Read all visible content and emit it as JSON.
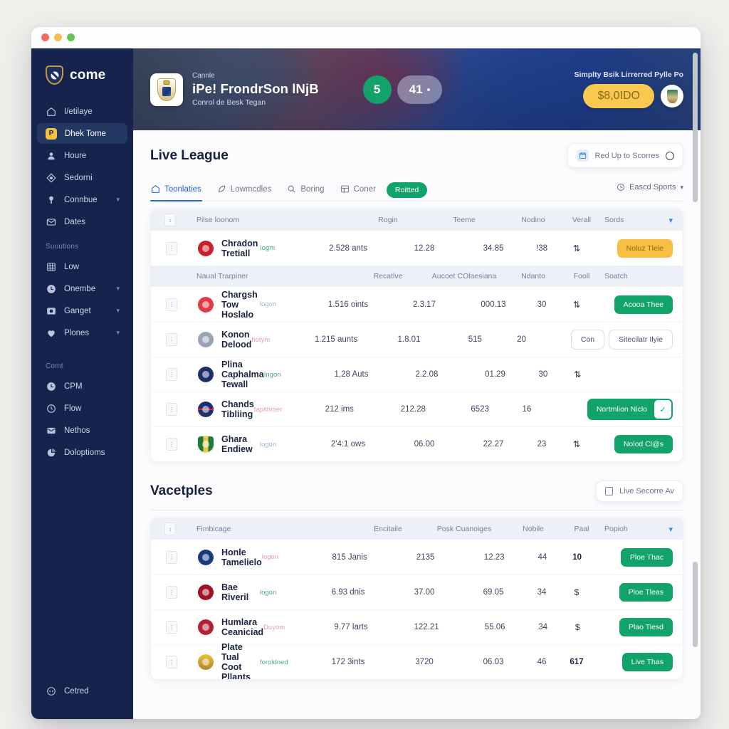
{
  "window": {
    "traffic_lights": [
      "close",
      "minimize",
      "zoom"
    ]
  },
  "sidebar": {
    "brand": "come",
    "sections": [
      {
        "label": "",
        "items": [
          {
            "label": "I/etilaye",
            "icon": "home-icon",
            "active": false,
            "chevron": false
          },
          {
            "label": "Dhek Tome",
            "icon": "badge-p-icon",
            "active": true,
            "chevron": false
          },
          {
            "label": "Houre",
            "icon": "user-icon",
            "active": false,
            "chevron": false
          },
          {
            "label": "Sedorni",
            "icon": "diamond-icon",
            "active": false,
            "chevron": false
          },
          {
            "label": "Connbue",
            "icon": "pin-icon",
            "active": false,
            "chevron": true
          },
          {
            "label": "Dates",
            "icon": "mail-icon",
            "active": false,
            "chevron": false
          }
        ]
      },
      {
        "label": "Suuutions",
        "items": [
          {
            "label": "Low",
            "icon": "grid-icon",
            "active": false,
            "chevron": false
          },
          {
            "label": "Onembe",
            "icon": "clock-icon",
            "active": false,
            "chevron": true
          },
          {
            "label": "Ganget",
            "icon": "camera-icon",
            "active": false,
            "chevron": true
          },
          {
            "label": "Plones",
            "icon": "heart-icon",
            "active": false,
            "chevron": true
          }
        ]
      },
      {
        "label": "Comt",
        "items": [
          {
            "label": "CPM",
            "icon": "clock-icon",
            "active": false,
            "chevron": false
          },
          {
            "label": "Flow",
            "icon": "clock-icon",
            "active": false,
            "chevron": false
          },
          {
            "label": "Nethos",
            "icon": "mail-icon",
            "active": false,
            "chevron": false
          },
          {
            "label": "Doloptioms",
            "icon": "pie-icon",
            "active": false,
            "chevron": false
          }
        ]
      }
    ],
    "bottom": {
      "label": "Cetred",
      "icon": "help-circle-icon"
    }
  },
  "hero": {
    "kicker": "Cannle",
    "title": "iPe! FrondrSon lNjB",
    "subtitle": "Conrol de Besk Tegan",
    "crest": "team-crest-icon",
    "score_home": "5",
    "score_away": "41",
    "right_label": "Simplty Bsik Lirrerred Pylle Po",
    "money": "$8,0IDO",
    "avatar": "trophy-avatar-icon"
  },
  "section1": {
    "title": "Live League",
    "action_chip": {
      "label": "Red Up to Scorres",
      "icon": "calendar-icon",
      "trailing": "ring-icon"
    },
    "tabs": [
      {
        "label": "Toonlaties",
        "icon": "home-outline-icon",
        "active": true
      },
      {
        "label": "Lowmcdles",
        "icon": "leaf-icon",
        "active": false
      },
      {
        "label": "Boring",
        "icon": "search-icon",
        "active": false
      },
      {
        "label": "Coner",
        "icon": "grid-small-icon",
        "active": false
      }
    ],
    "tab_pill": "Roitted",
    "tabs_right": {
      "label": "Eascd Sports",
      "icon": "clock-icon",
      "chevron": "chevron-down-icon"
    },
    "table": {
      "columns": [
        "Pilse loonom",
        "Rogin",
        "Teeme",
        "Nodino",
        "Verall",
        "Sords"
      ],
      "columns2": [
        "Naual Trarpiner",
        "Recatlve",
        "Aucoet COlaesiana",
        "Ndanto",
        "Fooll",
        "Soatch"
      ],
      "rows_top": [
        {
          "name": "Chradon Tretiall",
          "tag": "Iogm",
          "tag_color": "#35b07a",
          "crest_color": "#c8202b",
          "crest_shape": "circle",
          "c1": "2.528 ants",
          "c2": "12.28",
          "c3": "34.85",
          "c4": "!38",
          "c5_icon": "updown-icon",
          "c5_text": "",
          "action": {
            "label": "Noluz Tlele",
            "style": "amber"
          }
        }
      ],
      "rows": [
        {
          "name": "Chargsh Tow Hoslalo",
          "tag": "logon",
          "tag_color": "#9fb5d8",
          "crest_color": "#e03a46",
          "crest_shape": "circle",
          "c1": "1.516 oints",
          "c2": "2.3.17",
          "c3": "000.13",
          "c4": "30",
          "c5_icon": "updown-icon",
          "c5_text": "",
          "action": {
            "label": "Acooa Thee",
            "style": "green"
          }
        },
        {
          "name": "Konon Delood",
          "tag": "hotym",
          "tag_color": "#e59ab5",
          "crest_color": "#9aa3b4",
          "crest_shape": "circle",
          "c1": "1.215 aunts",
          "c2": "1.8.01",
          "c3": "515",
          "c4": "20",
          "c5_icon": "",
          "c5_text": "",
          "action": {
            "label": "Sitecilatr Ilyie",
            "style": "outline",
            "secondary": "Con"
          }
        },
        {
          "name": "Plina Caphalma Tewall",
          "tag": "Ingon",
          "tag_color": "#4faa7d",
          "crest_color": "#1d2f6b",
          "crest_shape": "circle",
          "c1": "1,28 Auts",
          "c2": "2.2.08",
          "c3": "01.29",
          "c4": "30",
          "c5_icon": "updown-icon",
          "c5_text": "",
          "action": null
        },
        {
          "name": "Chands Tibliing",
          "tag": "tapithmer",
          "tag_color": "#e59ab5",
          "crest_color": "#c8202b",
          "crest_shape": "circle",
          "c1": "212 ims",
          "c2": "212.28",
          "c3": "6523",
          "c4": "16",
          "c5_icon": "",
          "c5_text": "",
          "action": {
            "label": "Nortmlion Niclo",
            "style": "split",
            "check": "check-icon"
          }
        },
        {
          "name": "Ghara Endiew",
          "tag": "logon",
          "tag_color": "#9fb5d8",
          "crest_color": "#1f7a3a",
          "crest_shape": "shield",
          "c1": "2'4:1 ows",
          "c2": "06.00",
          "c3": "22.27",
          "c4": "23",
          "c5_icon": "updown-icon",
          "c5_text": "",
          "action": {
            "label": "Nolod Cl@s",
            "style": "green"
          }
        }
      ]
    }
  },
  "section2": {
    "title": "Vacetples",
    "action_chip": {
      "label": "Live Secorre Av",
      "icon": "square-outline-icon"
    },
    "table": {
      "columns": [
        "Fimbicage",
        "Encitaile",
        "Posk Cuanoiges",
        "Nobile",
        "Paal",
        "Popioh"
      ],
      "rows": [
        {
          "name": "Honle Tamelielo",
          "tag": "logon",
          "tag_color": "#e59ab5",
          "crest_color": "#1b3a7a",
          "crest_shape": "circle",
          "c1": "815 Janis",
          "c2": "2135",
          "c3": "12.23",
          "c4": "44",
          "c5_icon": "",
          "c5_text": "10",
          "action": {
            "label": "Ploe Thac",
            "style": "green"
          }
        },
        {
          "name": "Bae Riveril",
          "tag": "logon",
          "tag_color": "#4faa7d",
          "crest_color": "#9e1221",
          "crest_shape": "circle",
          "c1": "6.93 dnis",
          "c2": "37.00",
          "c3": "69.05",
          "c4": "34",
          "c5_icon": "dollar-icon",
          "c5_text": "",
          "action": {
            "label": "Ploe Tleas",
            "style": "green"
          }
        },
        {
          "name": "Humlara Ceaniciad",
          "tag": "Duyom",
          "tag_color": "#e59ab5",
          "crest_color": "#b02233",
          "crest_shape": "circle",
          "c1": "9.77 larts",
          "c2": "122.21",
          "c3": "55.06",
          "c4": "34",
          "c5_icon": "dollar-icon",
          "c5_text": "",
          "action": {
            "label": "Plao Tiesd",
            "style": "green"
          }
        },
        {
          "name": "Plate Tual Coot Pllants",
          "tag": "foroldned",
          "tag_color": "#4faa7d",
          "crest_color": "#d2a33c",
          "crest_shape": "circle",
          "c1": "172 3ints",
          "c2": "3720",
          "c3": "06.03",
          "c4": "46",
          "c5_icon": "",
          "c5_text": "617",
          "action": {
            "label": "Live Thas",
            "style": "green"
          }
        }
      ]
    }
  },
  "colors": {
    "sidebar_bg": "#16244d",
    "accent_blue": "#2563eb",
    "accent_green": "#12a36b",
    "accent_amber": "#f8bf45",
    "header_row_bg": "#eef0f7"
  }
}
